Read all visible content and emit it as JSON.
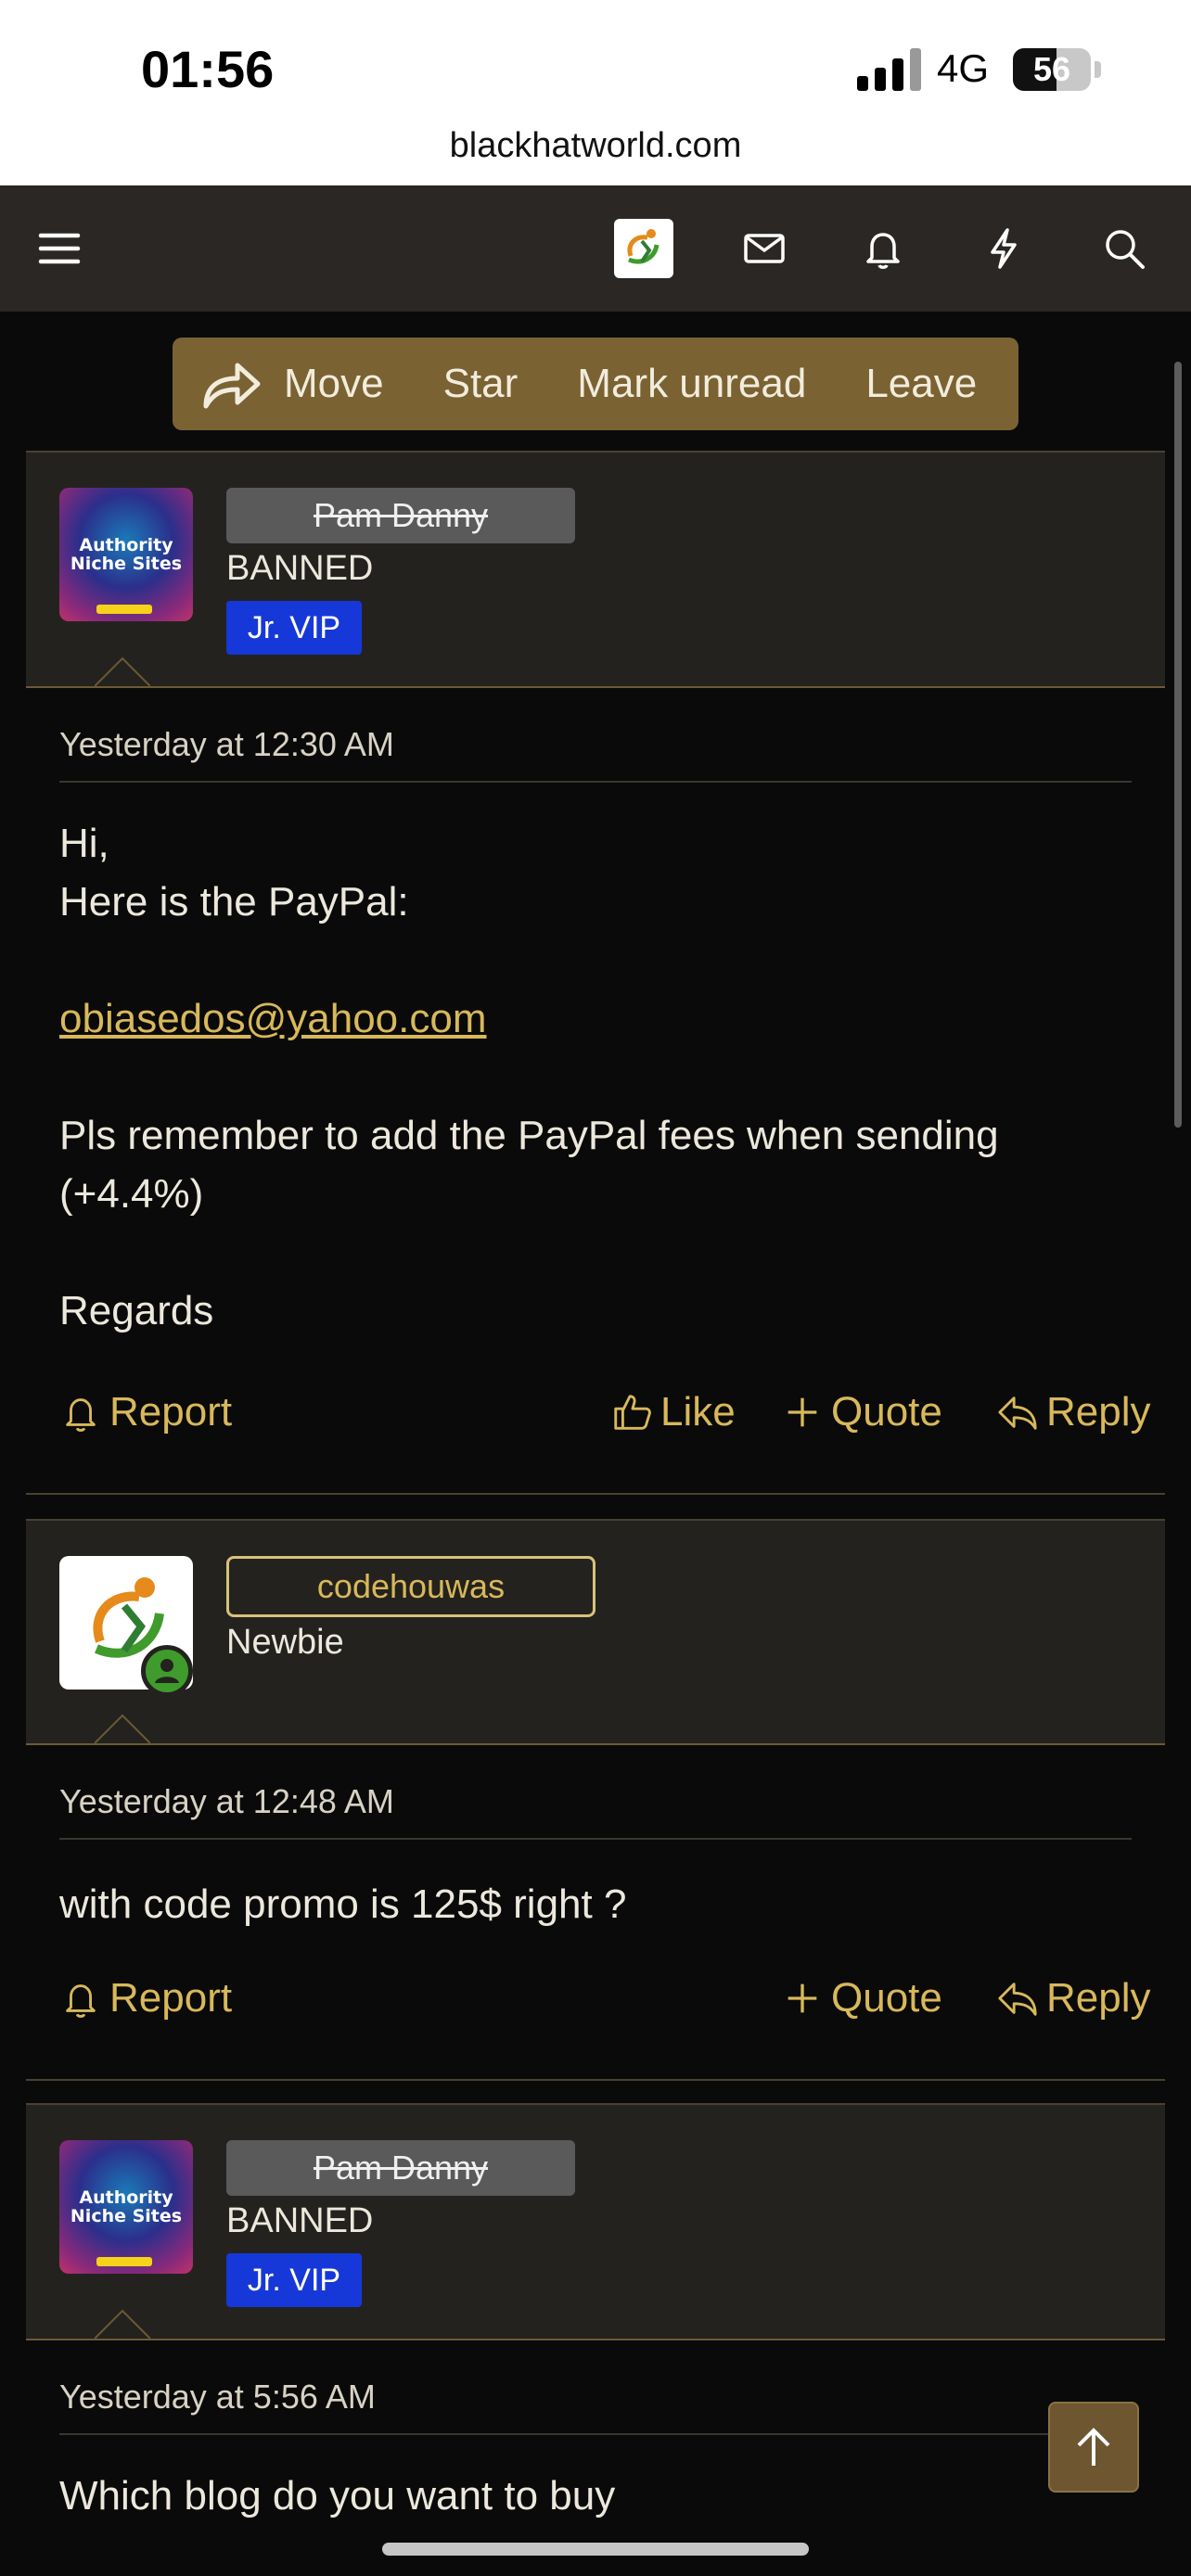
{
  "status_bar": {
    "time": "01:56",
    "network": "4G",
    "battery": "56",
    "battery_level": 0.56
  },
  "browser": {
    "url": "blackhatworld.com"
  },
  "nav": {
    "icons": [
      "menu-icon",
      "site-logo-icon",
      "mail-icon",
      "bell-icon",
      "lightning-icon",
      "search-icon"
    ]
  },
  "action_bar": {
    "move": "Move",
    "star": "Star",
    "mark_unread": "Mark unread",
    "leave": "Leave"
  },
  "posts": [
    {
      "username": "Pam Danny",
      "user_title": "BANNED",
      "badge": "Jr. VIP",
      "avatar_text": "Authority Niche Sites",
      "date": "Yesterday at 12:30 AM",
      "body": {
        "line1": "Hi,",
        "line2": "Here is the PayPal:",
        "email": "obiasedos@yahoo.com",
        "line3": "Pls remember to add the PayPal fees when sending",
        "line4": "(+4.4%)",
        "line5": "Regards"
      },
      "actions": {
        "report": "Report",
        "like": "Like",
        "quote": "Quote",
        "reply": "Reply"
      }
    },
    {
      "username": "codehouwas",
      "user_title": "Newbie",
      "date": "Yesterday at 12:48 AM",
      "body": {
        "line1": "with code promo is 125$ right ?"
      },
      "actions": {
        "report": "Report",
        "quote": "Quote",
        "reply": "Reply"
      }
    },
    {
      "username": "Pam Danny",
      "user_title": "BANNED",
      "badge": "Jr. VIP",
      "avatar_text": "Authority Niche Sites",
      "date": "Yesterday at 5:56 AM",
      "body": {
        "line1": "Which blog do you want to buy"
      }
    }
  ],
  "colors": {
    "accent": "#d8b85a",
    "action_bar": "#7a6233",
    "header_bg": "#24221f",
    "badge": "#1738d8"
  }
}
